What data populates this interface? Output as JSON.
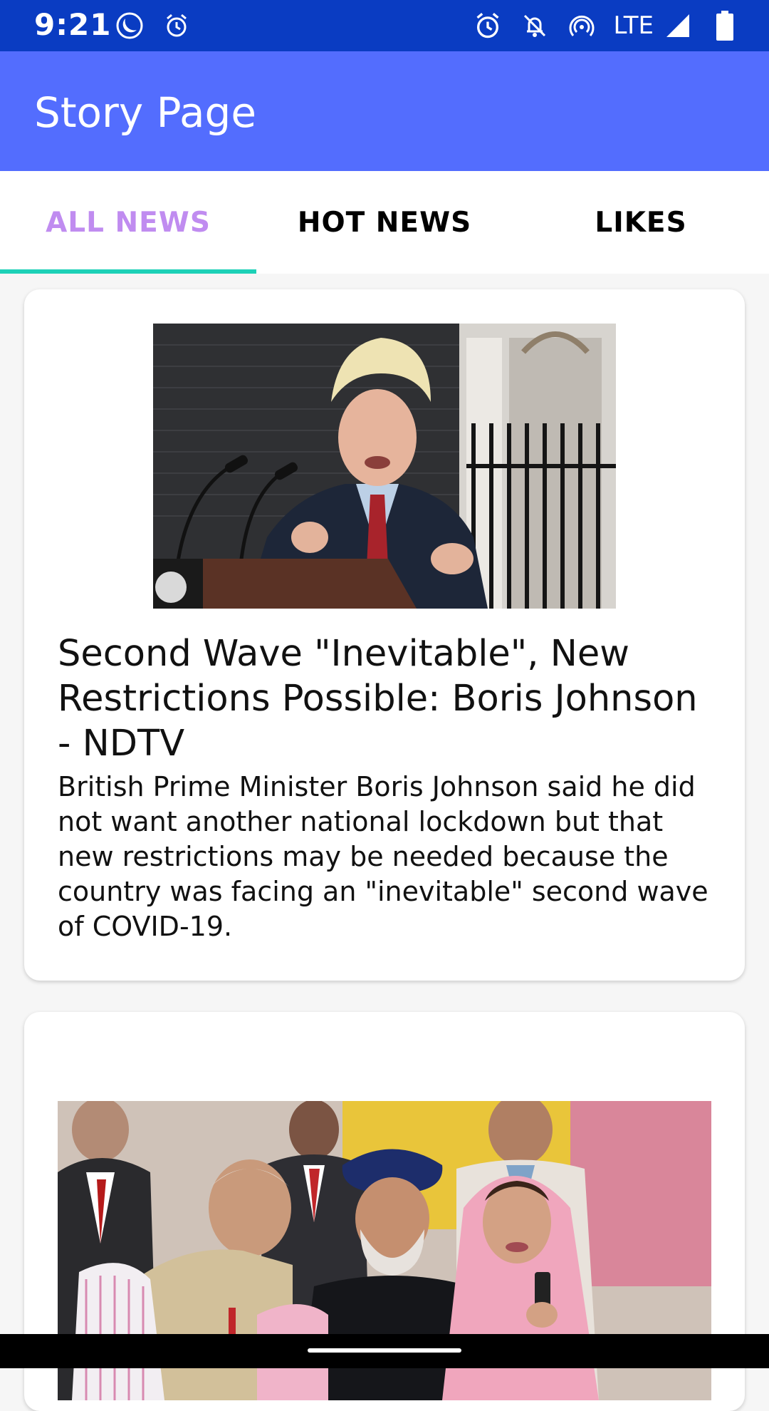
{
  "status_bar": {
    "time": "9:21",
    "network_label": "LTE",
    "icons": [
      "do-not-disturb-icon",
      "alarm-icon",
      "alarm-icon",
      "notifications-off-icon",
      "hotspot-icon",
      "signal-icon",
      "battery-icon"
    ]
  },
  "app_bar": {
    "title": "Story Page"
  },
  "tabs": [
    {
      "label": "ALL NEWS",
      "active": true
    },
    {
      "label": "HOT NEWS",
      "active": false
    },
    {
      "label": "LIKES",
      "active": false
    }
  ],
  "colors": {
    "status_bar": "#0a3cc2",
    "app_bar": "#536dfe",
    "active_tab_text": "#c08cf0",
    "tab_indicator": "#1dd1b7"
  },
  "articles": [
    {
      "headline": "Second Wave \"Inevitable\", New Restrictions Possible: Boris Johnson - NDTV",
      "summary": "British Prime Minister Boris Johnson said he did not want another national lockdown but that new restrictions may be needed because the country was facing an \"inevitable\" second wave of COVID-19."
    },
    {
      "headline": "",
      "summary": ""
    }
  ]
}
